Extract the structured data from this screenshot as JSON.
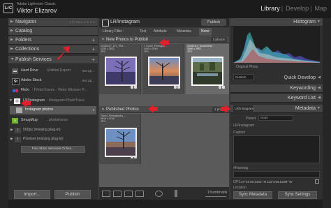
{
  "app": {
    "catalog": "Adobe Lightroom Classic",
    "user": "Viktor Elizarov",
    "logo": "LrC"
  },
  "modules": [
    "Library",
    "Develop",
    "Map"
  ],
  "left_panel": {
    "navigator": "Navigator",
    "nav_modes": "FIT  FILL  1:1  3:1",
    "catalog": "Catalog",
    "folders": "Folders",
    "collections": "Collections",
    "publish_services": "Publish Services",
    "services": [
      {
        "name": "Hard Drive",
        "desc": "Untitled Export",
        "btn": "Set Up..."
      },
      {
        "name": "Adobe Stock",
        "desc": "",
        "btn": "Set Up..."
      },
      {
        "name": "Flickr",
        "desc": ": PhotoTraces - Viktor Elizarov P...",
        "btn": ""
      },
      {
        "name": "LR/Instagram",
        "desc": ": Instagram PhotoTrace",
        "btn": ""
      },
      {
        "name": "Instagram photos",
        "desc": "",
        "btn": "4"
      },
      {
        "name": "SmugMug",
        "desc": ": phototraces",
        "btn": ""
      },
      {
        "name": "500px (missing plug-in)",
        "desc": "",
        "btn": ""
      },
      {
        "name": "Pixelset (missing plug-in)",
        "desc": "",
        "btn": ""
      },
      {
        "name": "Find More Services Online...",
        "desc": "",
        "btn": ""
      }
    ],
    "import": "Import...",
    "publish": "Publish"
  },
  "center": {
    "title": "LR/Instagram",
    "publish_btn": "Publish",
    "filter": [
      "Library Filter :",
      "Text",
      "Attribute",
      "Metadata",
      "None"
    ],
    "new_section": "New Photos to Publish",
    "new_count": "3 photos",
    "published_section": "Published Photos",
    "published_count": "1 photo",
    "new_photos": [
      {
        "caption": "20180117_071_Pho...\n4256 x 2832\nJPG"
      },
      {
        "caption": "1  Travel_Photogra...\n4928 x 3264\nJPG"
      },
      {
        "caption": "20180113_SouthWest...\n3888 x 2592\nJPG"
      }
    ],
    "published_photos": [
      {
        "caption": "Travel_Photography_...\n5616 x 3744\nJPG"
      }
    ],
    "thumbnails": "Thumbnails"
  },
  "right_panel": {
    "histogram": "Histogram",
    "original_photo": "Original Photo",
    "custom": "Custom",
    "quick_develop": "Quick Develop",
    "keywording": "Keywording",
    "keyword_list": "Keyword List",
    "metadata_preset": "LR/Instagram",
    "metadata": "Metadata",
    "preset_label": "Preset",
    "preset_value": "None",
    "lr_instagram": "LR/Instagram",
    "caption_label": "Caption",
    "hashtag_label": "#Hashtag",
    "gps_label": "GPS",
    "gps_value": "37°31'38.2431\" N 112°0'28.5238\" W",
    "location_label": "Location",
    "sync_metadata": "Sync Metadata",
    "sync_settings": "Sync Settings"
  },
  "accent": "#e0202a"
}
